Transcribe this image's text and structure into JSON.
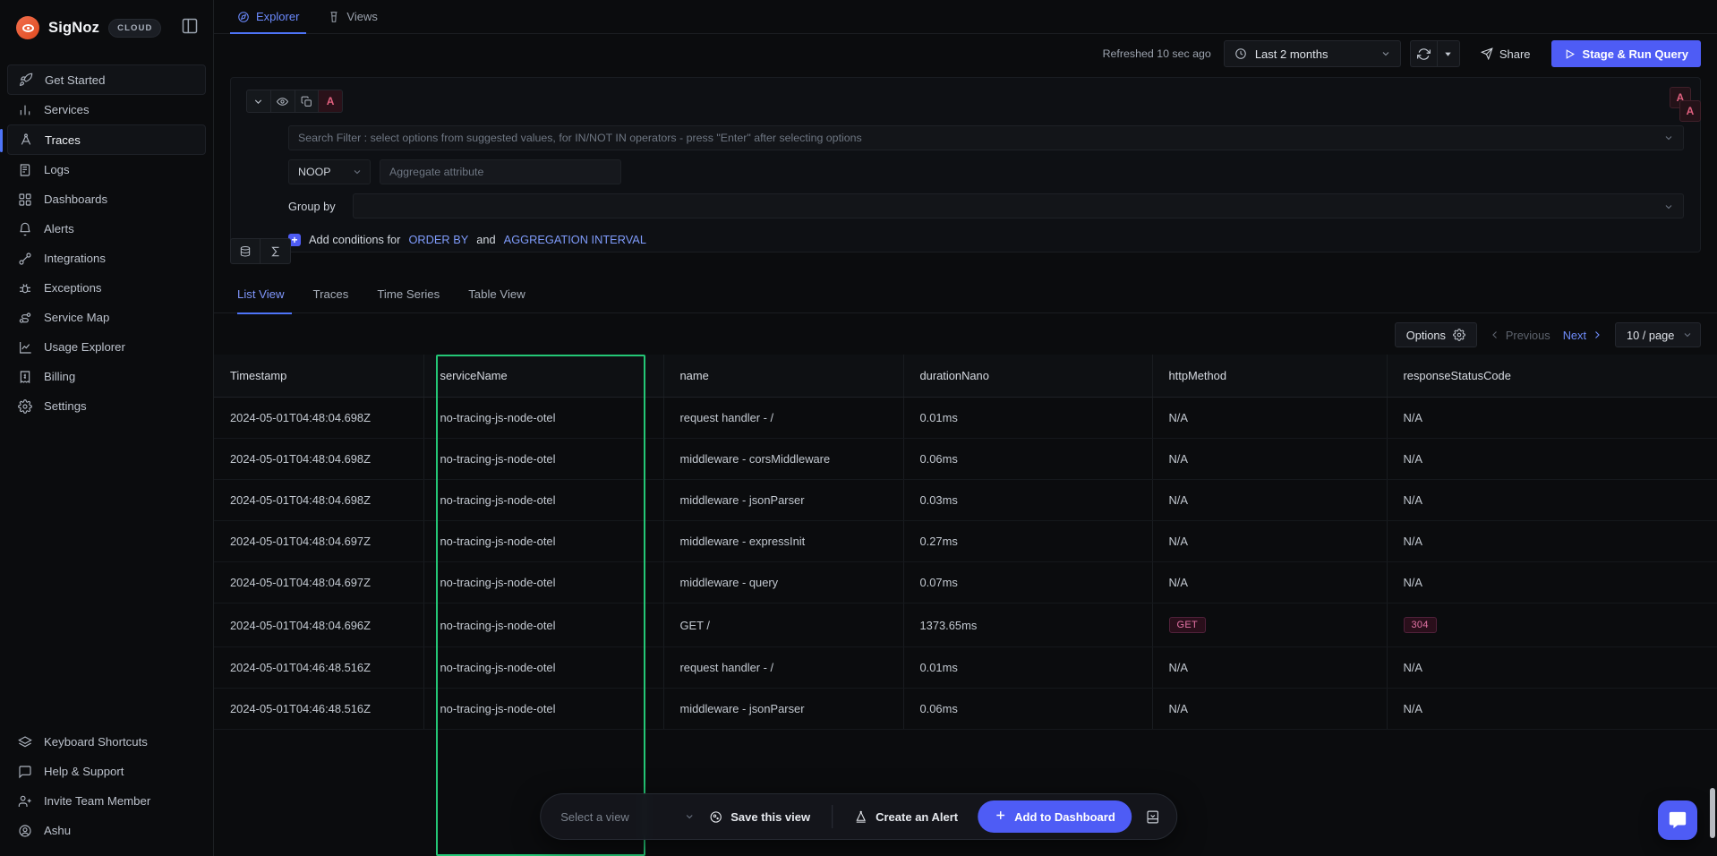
{
  "brand": {
    "name": "SigNoz",
    "plan_badge": "CLOUD",
    "logo_icon": "signoz-eye-logo",
    "panel_toggle_icon": "panel-toggle-icon"
  },
  "sidebar": {
    "items": [
      {
        "label": "Get Started",
        "icon": "rocket-icon",
        "state": "boxed"
      },
      {
        "label": "Services",
        "icon": "bar-chart-icon",
        "state": "default"
      },
      {
        "label": "Traces",
        "icon": "traces-icon",
        "state": "active"
      },
      {
        "label": "Logs",
        "icon": "logs-icon",
        "state": "default"
      },
      {
        "label": "Dashboards",
        "icon": "grid-icon",
        "state": "default"
      },
      {
        "label": "Alerts",
        "icon": "bell-icon",
        "state": "default"
      },
      {
        "label": "Integrations",
        "icon": "plug-icon",
        "state": "default"
      },
      {
        "label": "Exceptions",
        "icon": "bug-icon",
        "state": "default"
      },
      {
        "label": "Service Map",
        "icon": "service-map-icon",
        "state": "default"
      },
      {
        "label": "Usage Explorer",
        "icon": "usage-chart-icon",
        "state": "default"
      },
      {
        "label": "Billing",
        "icon": "receipt-icon",
        "state": "default"
      },
      {
        "label": "Settings",
        "icon": "gear-icon",
        "state": "default"
      }
    ],
    "bottom_items": [
      {
        "label": "Keyboard Shortcuts",
        "icon": "keyboard-layers-icon"
      },
      {
        "label": "Help & Support",
        "icon": "message-icon"
      },
      {
        "label": "Invite Team Member",
        "icon": "user-plus-icon"
      },
      {
        "label": "Ashu",
        "icon": "user-circle-icon"
      }
    ]
  },
  "tabs": [
    {
      "label": "Explorer",
      "icon": "compass-icon",
      "active": true
    },
    {
      "label": "Views",
      "icon": "tower-icon",
      "active": false
    }
  ],
  "toolbar": {
    "refreshed_text": "Refreshed 10 sec ago",
    "time_range": "Last 2 months",
    "clock_icon": "clock-icon",
    "chevron_icon": "chevron-down-icon",
    "refresh_icon": "refresh-icon",
    "refresh_dropdown_icon": "caret-down-icon",
    "share_label": "Share",
    "share_icon": "share-send-icon",
    "run_query_label": "Stage & Run Query",
    "run_query_icon": "play-icon"
  },
  "query_builder": {
    "query_letter": "A",
    "right_badge_letter": "A",
    "collapse_icon": "chevron-down-icon",
    "visibility_icon": "eye-icon",
    "duplicate_icon": "copy-icon",
    "search_filter_placeholder": "Search Filter : select options from suggested values, for IN/NOT IN operators - press \"Enter\" after selecting options",
    "aggregate_operator": "NOOP",
    "aggregate_attribute_placeholder": "Aggregate attribute",
    "group_by_label": "Group by",
    "group_by_value": "",
    "add_conditions_prefix": "Add conditions for",
    "add_conditions_link1": "ORDER BY",
    "add_conditions_middle": "and",
    "add_conditions_link2": "AGGREGATION INTERVAL",
    "footer_query_icon": "database-query-icon",
    "footer_formula_icon": "sigma-icon"
  },
  "view_tabs": [
    {
      "label": "List View",
      "active": true
    },
    {
      "label": "Traces",
      "active": false
    },
    {
      "label": "Time Series",
      "active": false
    },
    {
      "label": "Table View",
      "active": false
    }
  ],
  "pagination": {
    "options_label": "Options",
    "options_icon": "gear-icon",
    "previous_label": "Previous",
    "previous_icon": "chevron-left-icon",
    "previous_enabled": false,
    "next_label": "Next",
    "next_icon": "chevron-right-icon",
    "next_enabled": true,
    "page_size": "10 / page",
    "page_size_chevron": "chevron-down-icon"
  },
  "table": {
    "columns": [
      "Timestamp",
      "serviceName",
      "name",
      "durationNano",
      "httpMethod",
      "responseStatusCode"
    ],
    "rows": [
      {
        "timestamp": "2024-05-01T04:48:04.698Z",
        "serviceName": "no-tracing-js-node-otel",
        "name": "request handler - /",
        "durationNano": "0.01ms",
        "httpMethod": "N/A",
        "responseStatusCode": "N/A",
        "httpMethodBadge": false,
        "responseStatusBadge": false
      },
      {
        "timestamp": "2024-05-01T04:48:04.698Z",
        "serviceName": "no-tracing-js-node-otel",
        "name": "middleware - corsMiddleware",
        "durationNano": "0.06ms",
        "httpMethod": "N/A",
        "responseStatusCode": "N/A",
        "httpMethodBadge": false,
        "responseStatusBadge": false
      },
      {
        "timestamp": "2024-05-01T04:48:04.698Z",
        "serviceName": "no-tracing-js-node-otel",
        "name": "middleware - jsonParser",
        "durationNano": "0.03ms",
        "httpMethod": "N/A",
        "responseStatusCode": "N/A",
        "httpMethodBadge": false,
        "responseStatusBadge": false
      },
      {
        "timestamp": "2024-05-01T04:48:04.697Z",
        "serviceName": "no-tracing-js-node-otel",
        "name": "middleware - expressInit",
        "durationNano": "0.27ms",
        "httpMethod": "N/A",
        "responseStatusCode": "N/A",
        "httpMethodBadge": false,
        "responseStatusBadge": false
      },
      {
        "timestamp": "2024-05-01T04:48:04.697Z",
        "serviceName": "no-tracing-js-node-otel",
        "name": "middleware - query",
        "durationNano": "0.07ms",
        "httpMethod": "N/A",
        "responseStatusCode": "N/A",
        "httpMethodBadge": false,
        "responseStatusBadge": false
      },
      {
        "timestamp": "2024-05-01T04:48:04.696Z",
        "serviceName": "no-tracing-js-node-otel",
        "name": "GET /",
        "durationNano": "1373.65ms",
        "httpMethod": "GET",
        "responseStatusCode": "304",
        "httpMethodBadge": true,
        "responseStatusBadge": true
      },
      {
        "timestamp": "2024-05-01T04:46:48.516Z",
        "serviceName": "no-tracing-js-node-otel",
        "name": "request handler - /",
        "durationNano": "0.01ms",
        "httpMethod": "N/A",
        "responseStatusCode": "N/A",
        "httpMethodBadge": false,
        "responseStatusBadge": false
      },
      {
        "timestamp": "2024-05-01T04:46:48.516Z",
        "serviceName": "no-tracing-js-node-otel",
        "name": "middleware - jsonParser",
        "durationNano": "0.06ms",
        "httpMethod": "N/A",
        "responseStatusCode": "N/A",
        "httpMethodBadge": false,
        "responseStatusBadge": false
      }
    ]
  },
  "floating_bar": {
    "select_view_placeholder": "Select a view",
    "select_view_chevron": "chevron-down-icon",
    "save_view_label": "Save this view",
    "save_view_icon": "save-disc-icon",
    "create_alert_label": "Create an Alert",
    "create_alert_icon": "alert-bell-icon",
    "add_dashboard_label": "Add to Dashboard",
    "add_dashboard_icon": "plus-icon",
    "extra_icon": "panel-bottom-icon"
  },
  "chat": {
    "icon": "chat-bubble-icon"
  },
  "colors": {
    "accent": "#4e5cf5",
    "accent_text": "#6f8cfa",
    "highlight_border": "#24c776",
    "badge_pink": "#e473a5",
    "brand_orange": "#e04a1f"
  }
}
